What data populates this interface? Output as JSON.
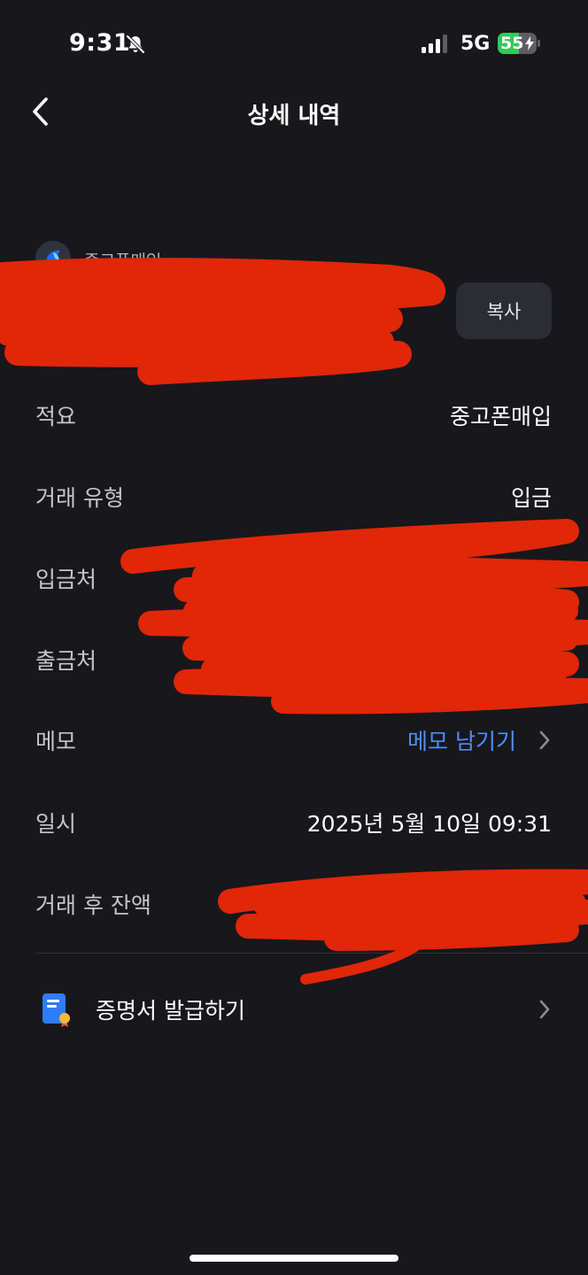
{
  "status_bar": {
    "time": "9:31",
    "network": "5G",
    "battery_percent": "55",
    "battery_level": 55
  },
  "nav": {
    "title": "상세 내역"
  },
  "account": {
    "name": "중고폰매입",
    "copy_label": "복사"
  },
  "details": {
    "summary_label": "적요",
    "summary_value": "중고폰매입",
    "type_label": "거래 유형",
    "type_value": "입금",
    "deposit_to_label": "입금처",
    "withdraw_from_label": "출금처",
    "memo_label": "메모",
    "memo_action": "메모 남기기",
    "datetime_label": "일시",
    "datetime_value": "2025년 5월 10일 09:31",
    "balance_label": "거래 후 잔액"
  },
  "certificate": {
    "label": "증명서 발급하기"
  },
  "colors": {
    "background": "#17171c",
    "link": "#4f8ff7",
    "battery_green": "#34c759",
    "redaction_red": "#e02708"
  }
}
